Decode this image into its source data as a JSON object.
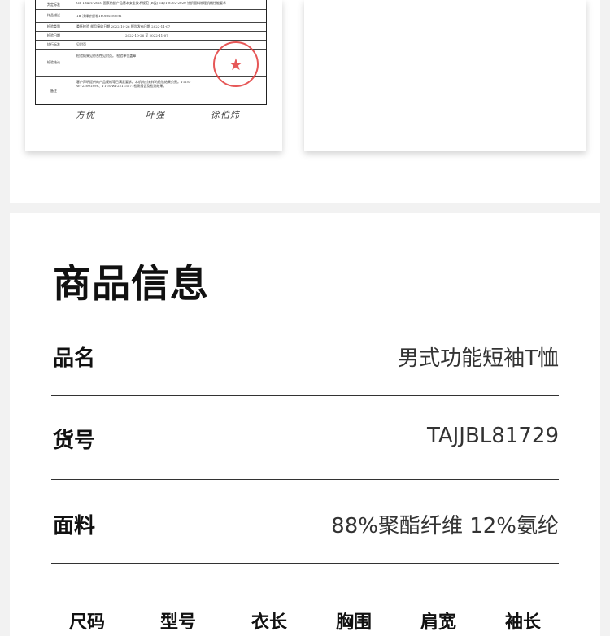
{
  "report": {
    "rows": [
      {
        "label": "判定标准",
        "text": "GB 18401-2010 国家纺织产品基本安全技术规范 (B类) GB/T 8702-2020 针织面料物理机械性能要求"
      },
      {
        "label": "样品描述",
        "text": "1# 浅绿针织物160cm×80cm"
      },
      {
        "label": "检验类别",
        "text": "委托检验    样品接收日期  2022-10-26    报告发布日期  2022-11-07"
      },
      {
        "label": "检验日期",
        "text": "2022-10-26    至    2022-11-07"
      },
      {
        "label": "执行标准",
        "text": "见附页"
      },
      {
        "label": "检验结论",
        "text": "检验结果见符合性见附页。                    检验单位盖章"
      },
      {
        "label": "备注",
        "text": "客户声明提供的产品规格等已满足要求。本机构对来样的检验结果负责。TTTS-WY22001898、TTTS-WY22115477检测报告及检测结果。"
      }
    ],
    "seal_mark": "★",
    "signatures": [
      "方优",
      "叶强",
      "徐伯炜"
    ]
  },
  "product_info": {
    "title": "商品信息",
    "rows": [
      {
        "label": "品名",
        "value": "男式功能短袖T恤"
      },
      {
        "label": "货号",
        "value": "TAJJBL81729"
      },
      {
        "label": "面料",
        "value": "88%聚酯纤维 12%氨纶"
      }
    ],
    "size_table_headers": [
      "尺码",
      "型号",
      "衣长",
      "胸围",
      "肩宽",
      "袖长"
    ]
  }
}
